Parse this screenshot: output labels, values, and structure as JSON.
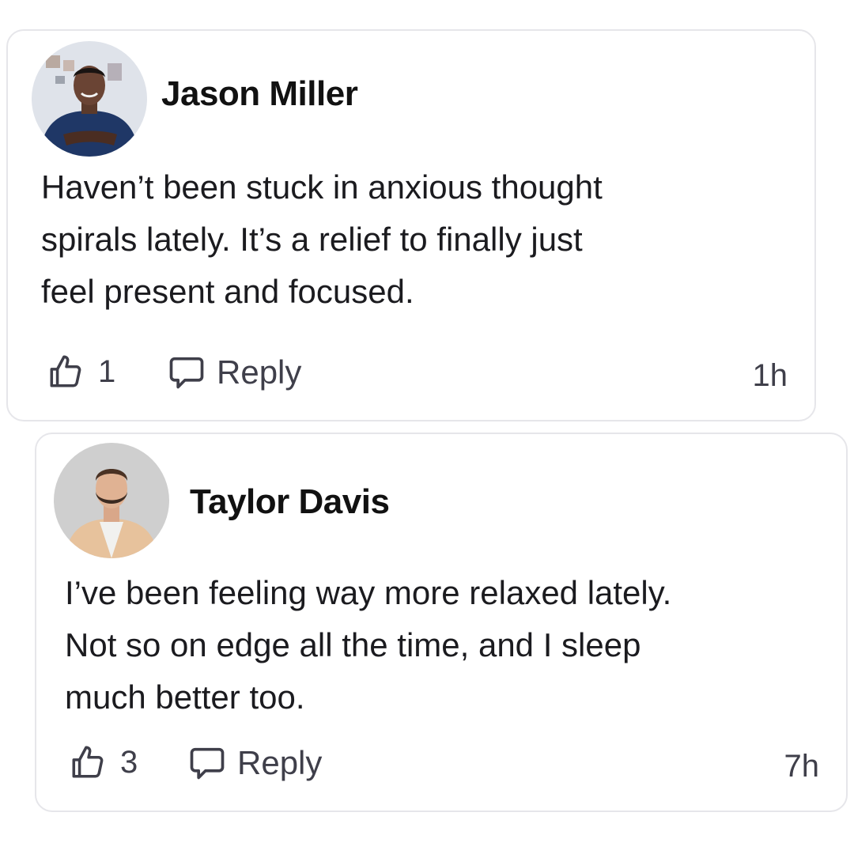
{
  "comments": [
    {
      "author": "Jason Miller",
      "text_lines": [
        "Haven’t been stuck in anxious thought",
        "spirals lately. It’s a relief to finally just",
        "feel present and focused."
      ],
      "likes": "1",
      "reply_label": "Reply",
      "time": "1h"
    },
    {
      "author": "Taylor Davis",
      "text_lines": [
        "I’ve been feeling way more relaxed lately.",
        "Not so on edge all the time, and I sleep",
        "much better too."
      ],
      "likes": "3",
      "reply_label": "Reply",
      "time": "7h"
    }
  ],
  "colors": {
    "card_border": "#e6e6ea",
    "icon_stroke": "#3f3f4a",
    "text_primary": "#111111"
  },
  "icons": {
    "like": "thumbs-up-icon",
    "reply": "chat-bubble-icon"
  }
}
